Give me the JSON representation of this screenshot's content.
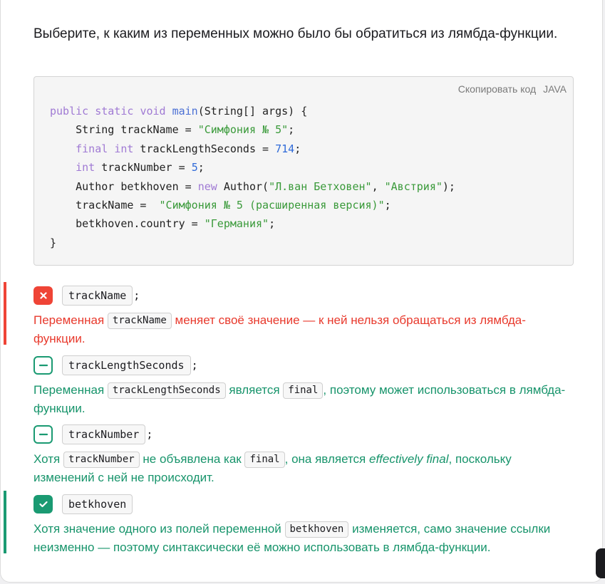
{
  "question": "Выберите, к каким из переменных можно было бы обратиться из лямбда-функции.",
  "code_box": {
    "copy_label": "Скопировать код",
    "language": "JAVA"
  },
  "code_lines": [
    "public static void main(String[] args) {",
    "    String trackName = \"Симфония № 5\";",
    "    final int trackLengthSeconds = 714;",
    "    int trackNumber = 5;",
    "    Author betkhoven = new Author(\"Л.ван Бетховен\", \"Австрия\");",
    "    trackName =  \"Симфония № 5 (расширенная версия)\";",
    "    betkhoven.country = \"Германия\";",
    "}"
  ],
  "answers": [
    {
      "status": "wrong",
      "option": "trackName",
      "suffix": ";",
      "explanation": {
        "part1": "Переменная",
        "code1": "trackName",
        "part2": "меняет своё значение — к ней нельзя обращаться из лямбда-функции."
      }
    },
    {
      "status": "missed",
      "option": "trackLengthSeconds",
      "suffix": ";",
      "explanation": {
        "part1": "Переменная",
        "code1": "trackLengthSeconds",
        "part2": "является",
        "code2": "final",
        "part3": ", поэтому может использоваться в лямбда-функции."
      }
    },
    {
      "status": "missed",
      "option": "trackNumber",
      "suffix": ";",
      "explanation": {
        "part1": "Хотя",
        "code1": "trackNumber",
        "part2": "не объявлена как",
        "code2": "final",
        "part3": ", она является",
        "em": "effectively final",
        "part4": ", поскольку изменений с ней не происходит."
      }
    },
    {
      "status": "correct",
      "option": "betkhoven",
      "explanation": {
        "part1": "Хотя значение одного из полей переменной",
        "code1": "betkhoven",
        "part2": "изменяется, само значение ссылки неизменно — поэтому синтаксически её можно использовать в лямбда-функции."
      }
    }
  ],
  "colors": {
    "wrong": "#ef4436",
    "correct": "#1a9a72"
  },
  "icons": {
    "wrong": "close-icon",
    "missed": "minus-icon",
    "correct": "check-icon"
  }
}
